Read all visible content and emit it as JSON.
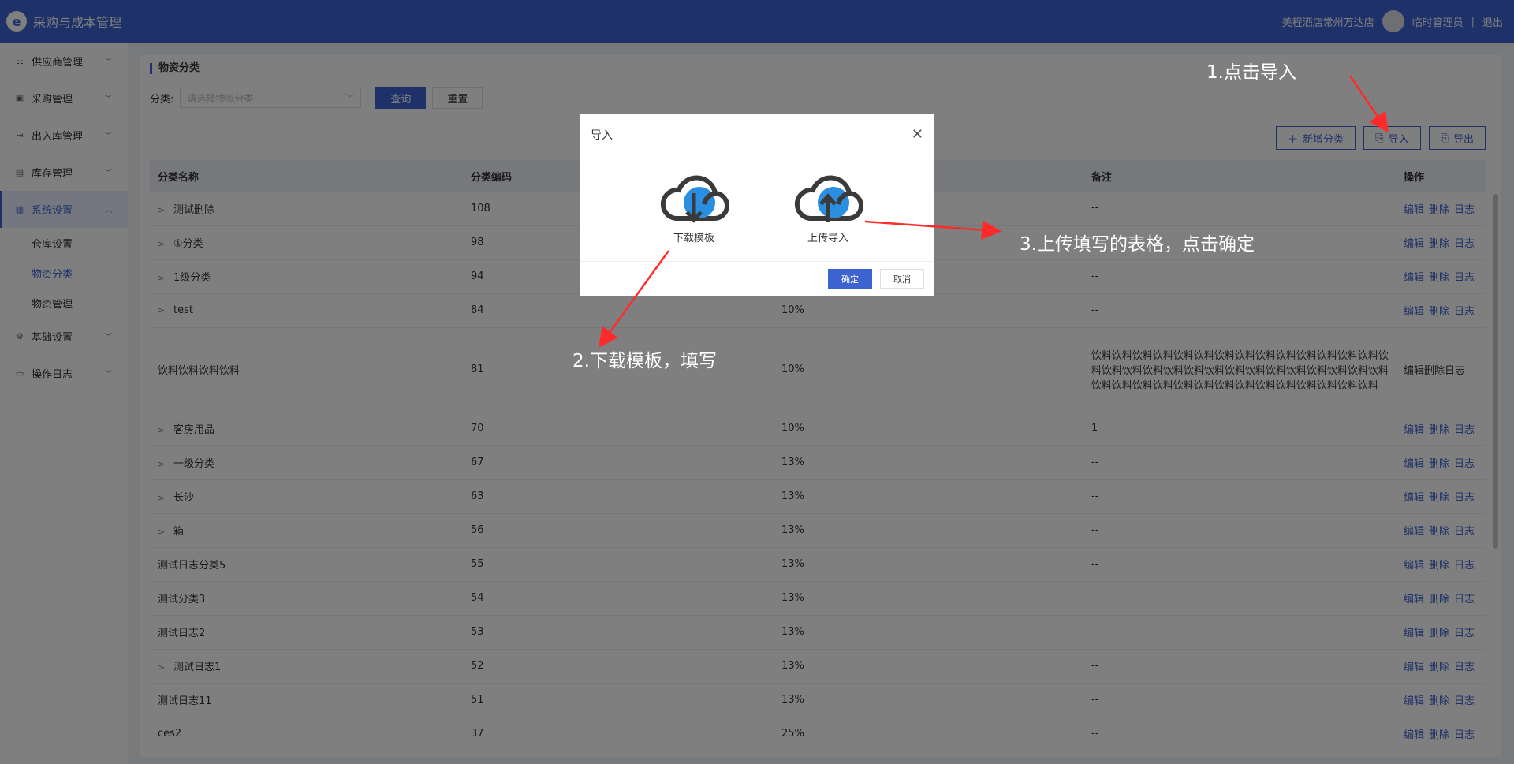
{
  "app": {
    "title": "采购与成本管理",
    "store": "美程酒店常州万达店",
    "user": "临时管理员",
    "separator": "|",
    "logout": "退出"
  },
  "sidebar": {
    "items": [
      {
        "label": "供应商管理",
        "icon": "supplier-icon"
      },
      {
        "label": "采购管理",
        "icon": "cart-icon"
      },
      {
        "label": "出入库管理",
        "icon": "inout-icon"
      },
      {
        "label": "库存管理",
        "icon": "inventory-icon"
      },
      {
        "label": "系统设置",
        "icon": "settings-icon",
        "active": true
      },
      {
        "label": "基础设置",
        "icon": "gear-icon"
      },
      {
        "label": "操作日志",
        "icon": "log-icon"
      }
    ],
    "sub_items": [
      "仓库设置",
      "物资分类",
      "物资管理"
    ]
  },
  "page": {
    "title": "物资分类",
    "filter_label": "分类:",
    "filter_placeholder": "请选择物资分类",
    "query_button": "查询",
    "reset_button": "重置",
    "add_button": "新增分类",
    "import_button": "导入",
    "export_button": "导出"
  },
  "table": {
    "headers": [
      "分类名称",
      "分类编码",
      "",
      "备注",
      "操作"
    ],
    "actions": [
      "编辑",
      "删除",
      "日志"
    ],
    "rows": [
      {
        "name": "测试删除",
        "code": "108",
        "rate": "",
        "remark": "--",
        "expand": true
      },
      {
        "name": "①分类",
        "code": "98",
        "rate": "",
        "remark": "",
        "expand": true
      },
      {
        "name": "1级分类",
        "code": "94",
        "rate": "",
        "remark": "--",
        "expand": true
      },
      {
        "name": "test",
        "code": "84",
        "rate": "10%",
        "remark": "--",
        "expand": true
      },
      {
        "name": "饮料饮料饮料饮料",
        "code": "81",
        "rate": "10%",
        "remark": "饮料饮料饮料饮料饮料饮料饮料饮料饮料饮料饮料饮料饮料饮料饮料饮料饮料饮料饮料饮料饮料饮料饮料饮料饮料饮料饮料饮料饮料饮料饮料饮料饮料饮料饮料饮料饮料饮料饮料饮料饮料饮料饮料",
        "expand": false,
        "tall": true
      },
      {
        "name": "客房用品",
        "code": "70",
        "rate": "10%",
        "remark": "1",
        "expand": true
      },
      {
        "name": "一级分类",
        "code": "67",
        "rate": "13%",
        "remark": "--",
        "expand": true
      },
      {
        "name": "长沙",
        "code": "63",
        "rate": "13%",
        "remark": "--",
        "expand": true
      },
      {
        "name": "箱",
        "code": "56",
        "rate": "13%",
        "remark": "--",
        "expand": true
      },
      {
        "name": "测试日志分类5",
        "code": "55",
        "rate": "13%",
        "remark": "--",
        "expand": false
      },
      {
        "name": "测试分类3",
        "code": "54",
        "rate": "13%",
        "remark": "--",
        "expand": false
      },
      {
        "name": "测试日志2",
        "code": "53",
        "rate": "13%",
        "remark": "--",
        "expand": false
      },
      {
        "name": "测试日志1",
        "code": "52",
        "rate": "13%",
        "remark": "--",
        "expand": true
      },
      {
        "name": "测试日志11",
        "code": "51",
        "rate": "13%",
        "remark": "--",
        "expand": false
      },
      {
        "name": "ces2",
        "code": "37",
        "rate": "25%",
        "remark": "--",
        "expand": false
      }
    ]
  },
  "dialog": {
    "title": "导入",
    "download_label": "下载模板",
    "upload_label": "上传导入",
    "confirm": "确定",
    "cancel": "取消"
  },
  "annotations": {
    "step1": "1.点击导入",
    "step2": "2.下载模板，填写",
    "step3": "3.上传填写的表格，点击确定"
  },
  "colors": {
    "primary": "#3d63d1",
    "cloud_blue": "#2a8fe0",
    "arrow": "#ff2a2a"
  }
}
